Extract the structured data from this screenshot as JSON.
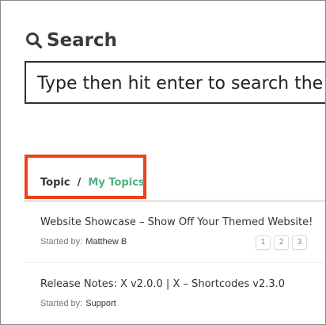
{
  "search": {
    "heading": "Search",
    "placeholder": "Type then hit enter to search the"
  },
  "topic_header": {
    "topic_label": "Topic",
    "separator": "/",
    "my_topics_label": "My Topics",
    "highlight_color": "#e8431b",
    "link_color": "#4fb07f"
  },
  "topics": [
    {
      "title": "Website Showcase – Show Off Your Themed Website!",
      "started_by_label": "Started by:",
      "author": "Matthew B",
      "pages": [
        "1",
        "2",
        "3"
      ]
    },
    {
      "title": "Release Notes: X v2.0.0 | X – Shortcodes v2.3.0",
      "started_by_label": "Started by:",
      "author": "Support"
    }
  ],
  "icons": {
    "search": "search-icon"
  }
}
